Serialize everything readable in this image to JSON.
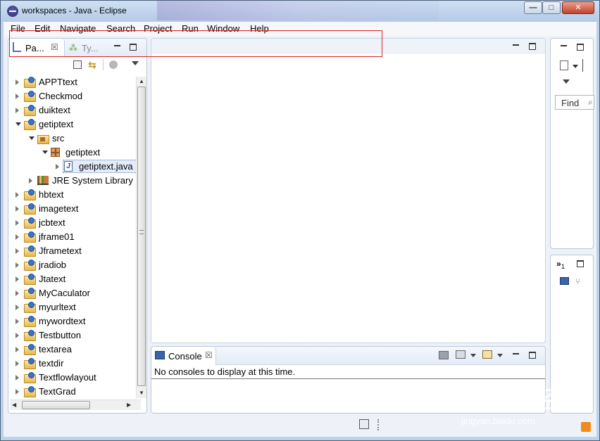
{
  "window": {
    "title": "workspaces - Java - Eclipse",
    "controls": {
      "minimize": "—",
      "maximize": "□",
      "close": "✕"
    }
  },
  "menu": [
    "File",
    "Edit",
    "Navigate",
    "Search",
    "Project",
    "Run",
    "Window",
    "Help"
  ],
  "package_explorer": {
    "tabs": [
      {
        "label": "Pa...",
        "icon": "package-explorer-icon",
        "active": true,
        "close": "☒"
      },
      {
        "label": "Ty...",
        "icon": "type-hierarchy-icon",
        "active": false
      }
    ],
    "tree": [
      {
        "label": "APPTtext",
        "type": "project",
        "level": 0,
        "expanded": false
      },
      {
        "label": "Checkmod",
        "type": "project",
        "level": 0,
        "expanded": false
      },
      {
        "label": "duiktext",
        "type": "project",
        "level": 0,
        "expanded": false
      },
      {
        "label": "getiptext",
        "type": "project",
        "level": 0,
        "expanded": true
      },
      {
        "label": "src",
        "type": "source-folder",
        "level": 1,
        "expanded": true
      },
      {
        "label": "getiptext",
        "type": "package",
        "level": 2,
        "expanded": true
      },
      {
        "label": "getiptext.java",
        "type": "java-file",
        "level": 3,
        "expanded": false,
        "selected": true
      },
      {
        "label": "JRE System Library",
        "type": "library",
        "level": 1,
        "expanded": false
      },
      {
        "label": "hbtext",
        "type": "project",
        "level": 0,
        "expanded": false
      },
      {
        "label": "imagetext",
        "type": "project",
        "level": 0,
        "expanded": false
      },
      {
        "label": "jcbtext",
        "type": "project",
        "level": 0,
        "expanded": false
      },
      {
        "label": "jframe01",
        "type": "project",
        "level": 0,
        "expanded": false
      },
      {
        "label": "Jframetext",
        "type": "project",
        "level": 0,
        "expanded": false
      },
      {
        "label": "jradiob",
        "type": "project",
        "level": 0,
        "expanded": false
      },
      {
        "label": "Jtatext",
        "type": "project",
        "level": 0,
        "expanded": false
      },
      {
        "label": "MyCaculator",
        "type": "project",
        "level": 0,
        "expanded": false
      },
      {
        "label": "myurltext",
        "type": "project",
        "level": 0,
        "expanded": false
      },
      {
        "label": "mywordtext",
        "type": "project",
        "level": 0,
        "expanded": false
      },
      {
        "label": "Testbutton",
        "type": "project",
        "level": 0,
        "expanded": false
      },
      {
        "label": "textarea",
        "type": "project",
        "level": 0,
        "expanded": false
      },
      {
        "label": "textdir",
        "type": "project",
        "level": 0,
        "expanded": false
      },
      {
        "label": "Textflowlayout",
        "type": "project",
        "level": 0,
        "expanded": false
      },
      {
        "label": "TextGrad",
        "type": "project",
        "level": 0,
        "expanded": false
      }
    ]
  },
  "console": {
    "tab_label": "Console",
    "tab_close": "☒",
    "message": "No consoles to display at this time."
  },
  "right_panel": {
    "find_placeholder": "Find",
    "overflow_label": "»",
    "overflow_count": "1"
  },
  "watermark": {
    "main": "Baidu经验",
    "sub": "jingyan.baidu.com"
  }
}
